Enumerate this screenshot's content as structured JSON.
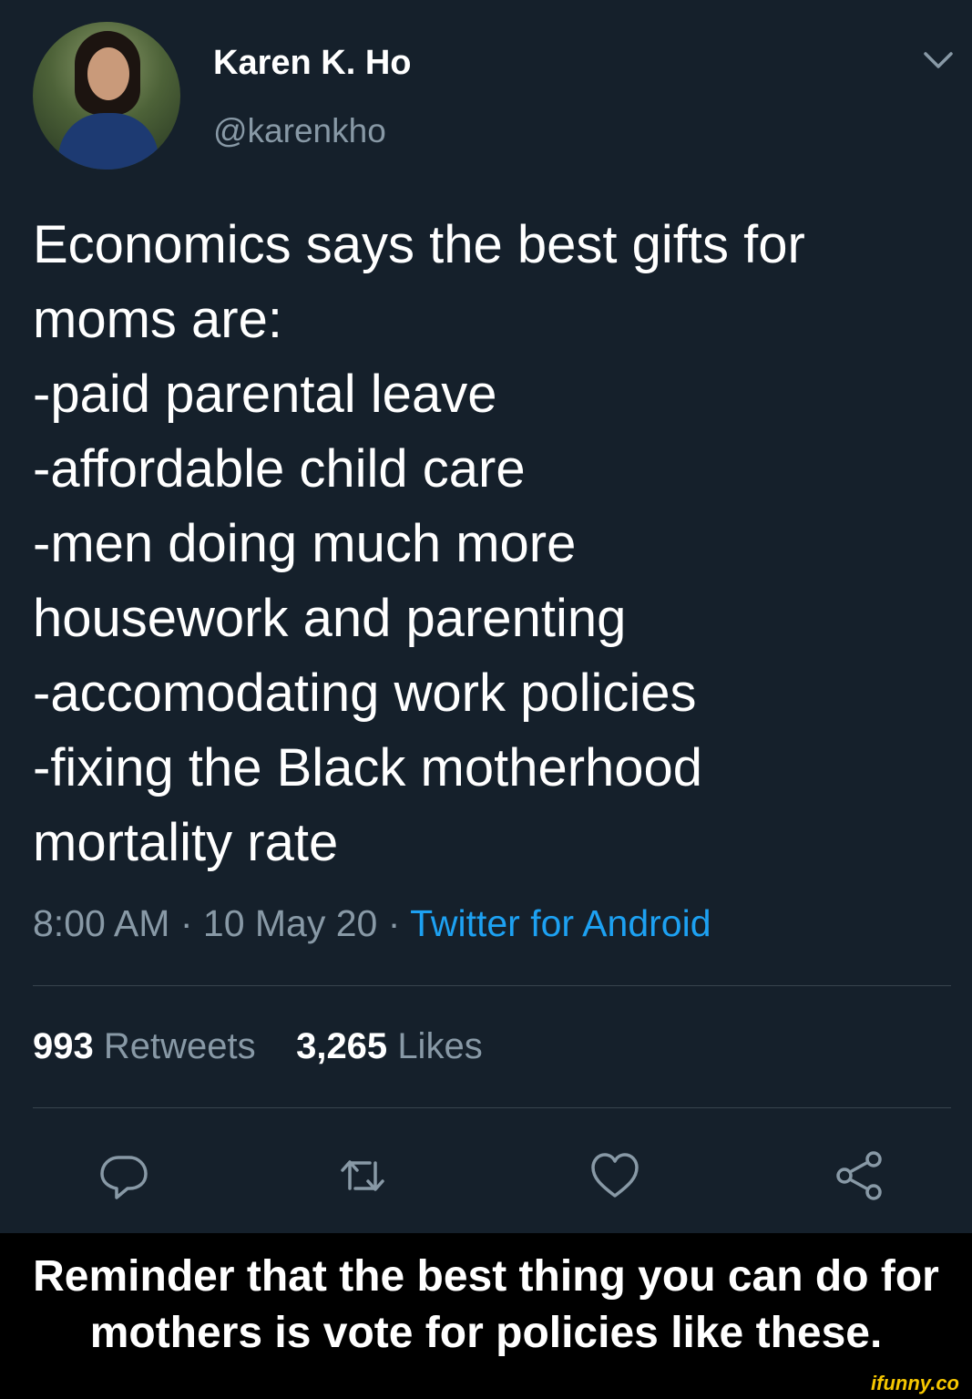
{
  "tweet": {
    "display_name": "Karen K. Ho",
    "handle": "@karenkho",
    "lines": [
      "Economics says the best gifts for",
      "moms are:",
      "-paid parental leave",
      "-affordable child care",
      "-men doing much more",
      "housework and parenting",
      "-accomodating work policies",
      "-fixing the Black motherhood",
      "mortality rate"
    ],
    "time": "8:00 AM",
    "date": "10 May 20",
    "separator": "·",
    "source": "Twitter for Android",
    "retweets_count": "993",
    "retweets_label": "Retweets",
    "likes_count": "3,265",
    "likes_label": "Likes",
    "icons": [
      "chevron-down-icon",
      "reply-icon",
      "retweet-icon",
      "like-icon",
      "share-icon"
    ]
  },
  "caption": {
    "line1": "Reminder that the best thing you can do for",
    "line2": "mothers is vote for policies like these."
  },
  "watermark": "ifunny.co",
  "colors": {
    "background": "#15202b",
    "text": "#ffffff",
    "secondary": "#8899a6",
    "link": "#1da1f2",
    "divider": "#38444d",
    "caption_bg": "#000000",
    "watermark": "#f6c700"
  }
}
